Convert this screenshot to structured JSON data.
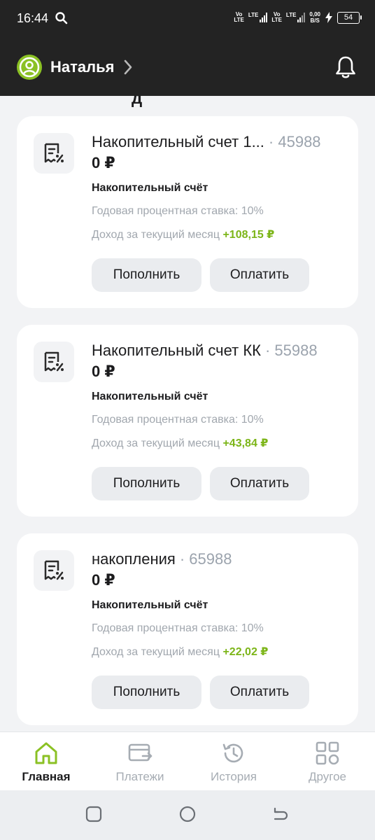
{
  "status": {
    "time": "16:44",
    "net1_top": "Vo",
    "net1_bottom": "LTE",
    "net1_label": "LTE",
    "net2_top": "Vo",
    "net2_bottom": "LTE",
    "net2_label": "LTE",
    "speed_value": "0,00",
    "speed_unit": "B/S",
    "battery": "54"
  },
  "header": {
    "user_name": "Наталья"
  },
  "peek_text": "д",
  "cards": [
    {
      "name": "Накопительный счет 1...",
      "number": "· 45988",
      "balance": "0 ₽",
      "type": "Накопительный счёт",
      "rate": "Годовая процентная ставка: 10%",
      "income_label": "Доход за текущий месяц",
      "income_amount": "+108,15 ₽",
      "topup_label": "Пополнить",
      "pay_label": "Оплатить"
    },
    {
      "name": "Накопительный счет КК",
      "number": "· 55988",
      "balance": "0 ₽",
      "type": "Накопительный счёт",
      "rate": "Годовая процентная ставка: 10%",
      "income_label": "Доход за текущий месяц",
      "income_amount": "+43,84 ₽",
      "topup_label": "Пополнить",
      "pay_label": "Оплатить"
    },
    {
      "name": "накопления",
      "number": "· 65988",
      "balance": "0 ₽",
      "type": "Накопительный счёт",
      "rate": "Годовая процентная ставка: 10%",
      "income_label": "Доход за текущий месяц",
      "income_amount": "+22,02 ₽",
      "topup_label": "Пополнить",
      "pay_label": "Оплатить"
    }
  ],
  "nav": [
    {
      "label": "Главная",
      "icon": "home-icon",
      "active": true
    },
    {
      "label": "Платежи",
      "icon": "payments-icon",
      "active": false
    },
    {
      "label": "История",
      "icon": "history-icon",
      "active": false
    },
    {
      "label": "Другое",
      "icon": "grid-icon",
      "active": false
    }
  ],
  "colors": {
    "accent": "#8bc124",
    "income": "#7cb518",
    "header_bg": "#232323"
  }
}
